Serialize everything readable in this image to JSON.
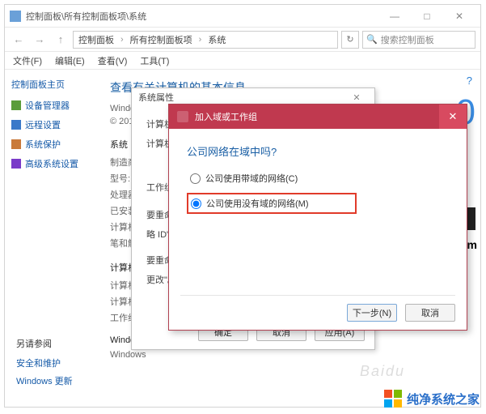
{
  "window": {
    "title": "控制面板\\所有控制面板项\\系统",
    "btn_min": "—",
    "btn_max": "□",
    "btn_close": "✕"
  },
  "nav": {
    "back": "←",
    "fwd": "→",
    "up": "↑",
    "crumb1": "控制面板",
    "crumb2": "所有控制面板项",
    "crumb3": "系统",
    "sep": "›",
    "refresh": "↻",
    "search_placeholder": "搜索控制面板",
    "search_icon": "🔍"
  },
  "menu": {
    "file": "文件(F)",
    "edit": "编辑(E)",
    "view": "查看(V)",
    "tools": "工具(T)"
  },
  "sidebar": {
    "home": "控制面板主页",
    "items": [
      "设备管理器",
      "远程设置",
      "系统保护",
      "高级系统设置"
    ],
    "footer_head": "另请参阅",
    "footer1": "安全和维护",
    "footer2": "Windows 更新"
  },
  "main": {
    "heading": "查看有关计算机的基本信息",
    "edition_label": "Windows",
    "copyright": "© 201",
    "help": "?",
    "sys_head": "系统",
    "rows": {
      "mfr": "制造商",
      "model": "型号:",
      "cpu": "处理器",
      "ram": "已安装",
      "type": "计算机类",
      "pen": "笔和触控"
    },
    "name_head": "计算机名",
    "name_rows": {
      "name": "计算机名",
      "desc": "计算机描",
      "workgroup": "工作组:"
    },
    "act_head": "Windows",
    "act_row": "Windows",
    "win10": "0",
    "tem": "tem"
  },
  "dlg2": {
    "title": "系统属性",
    "row1_label": "计算机名",
    "row2_label": "计算机描述",
    "row3_label": "工作组:",
    "hint1": "要重命名",
    "hint2": "略 ID\"。",
    "hint3": "要重命名",
    "hint4": "更改\"。",
    "ok": "确定",
    "cancel": "取消",
    "apply": "应用(A)",
    "close": "✕"
  },
  "dlg3": {
    "title": "加入域或工作组",
    "question": "公司网络在域中吗?",
    "opt1": "公司使用带域的网络(C)",
    "opt2": "公司使用没有域的网络(M)",
    "next": "下一步(N)",
    "cancel": "取消",
    "close": "✕"
  },
  "watermark": {
    "text": "纯净系统之家",
    "faint": "Baidu"
  }
}
